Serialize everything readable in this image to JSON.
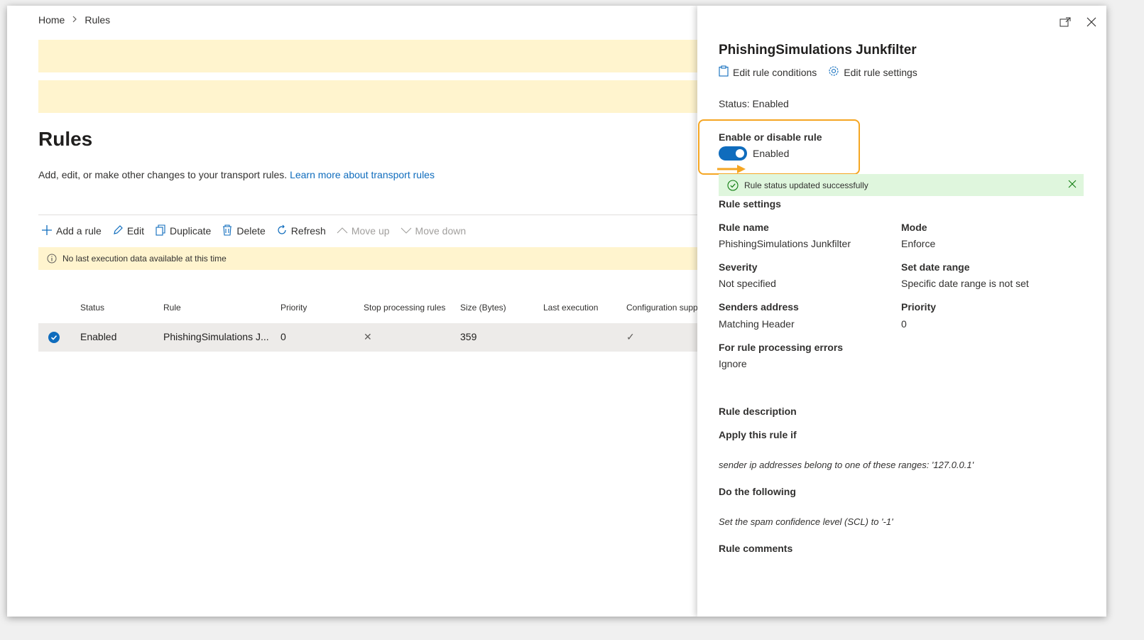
{
  "breadcrumb": {
    "home": "Home",
    "separator": ">",
    "current": "Rules"
  },
  "page": {
    "title": "Rules",
    "description": "Add, edit, or make other changes to your transport rules.",
    "learn_more": "Learn more about transport rules"
  },
  "toolbar": {
    "add": "Add a rule",
    "edit": "Edit",
    "duplicate": "Duplicate",
    "delete": "Delete",
    "refresh": "Refresh",
    "move_up": "Move up",
    "move_down": "Move down"
  },
  "info_bar": {
    "text": "No last execution data available at this time"
  },
  "table": {
    "columns": [
      "Status",
      "Rule",
      "Priority",
      "Stop processing rules",
      "Size (Bytes)",
      "Last execution",
      "Configuration supp"
    ],
    "rows": [
      {
        "status": "Enabled",
        "rule": "PhishingSimulations J...",
        "priority": "0",
        "stop_processing": "✕",
        "size": "359",
        "last_execution": "",
        "config": "✓"
      }
    ]
  },
  "panel": {
    "title": "PhishingSimulations Junkfilter",
    "edit_conditions": "Edit rule conditions",
    "edit_settings": "Edit rule settings",
    "status": "Status: Enabled",
    "toggle_label": "Enable or disable rule",
    "toggle_value": "Enabled",
    "toggle_on": true,
    "success": "Rule status updated successfully",
    "settings_heading": "Rule settings",
    "rule_name_label": "Rule name",
    "rule_name": "PhishingSimulations Junkfilter",
    "mode_label": "Mode",
    "mode": "Enforce",
    "severity_label": "Severity",
    "severity": "Not specified",
    "date_range_label": "Set date range",
    "date_range": "Specific date range is not set",
    "senders_label": "Senders address",
    "senders": "Matching Header",
    "priority_label": "Priority",
    "priority": "0",
    "errors_label": "For rule processing errors",
    "errors": "Ignore",
    "description_heading": "Rule description",
    "apply_if_label": "Apply this rule if",
    "apply_if": "sender ip addresses belong to one of these ranges: '127.0.0.1'",
    "do_following_label": "Do the following",
    "do_following": "Set the spam confidence level (SCL) to '-1'",
    "comments_label": "Rule comments"
  },
  "colors": {
    "accent": "#0f6cbd",
    "warning_bg": "#fff4ce",
    "success_bg": "#dff6dd",
    "highlight": "#f5a623"
  }
}
